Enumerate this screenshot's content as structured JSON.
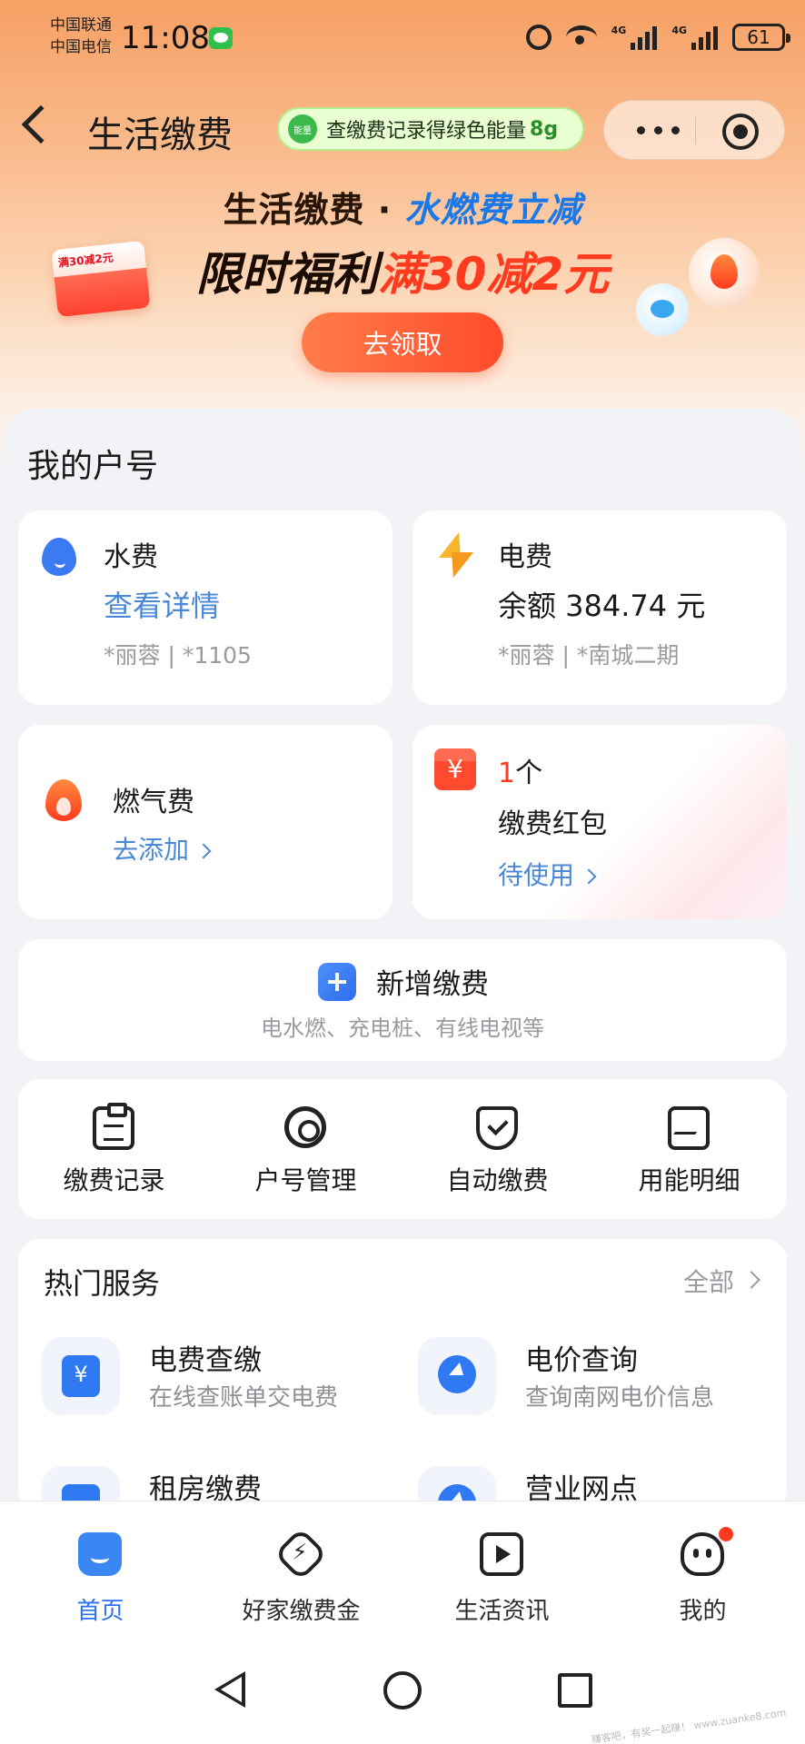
{
  "status_bar": {
    "carrier_1": "中国联通",
    "carrier_2": "中国电信",
    "time": "11:08",
    "net_1": "4G",
    "net_2": "4G",
    "battery": "61"
  },
  "header": {
    "title": "生活缴费",
    "energy_pill_badge": "能量",
    "energy_pill_text": "查缴费记录得绿色能量",
    "energy_pill_amount": "8g"
  },
  "banner": {
    "line1_prefix": "生活缴费 · ",
    "line1_highlight": "水燃费立减",
    "line2_prefix": "限时福利",
    "line2_highlight": "满30减2元",
    "redpack_label": "满30减2元",
    "button": "去领取"
  },
  "accounts": {
    "title": "我的户号",
    "water": {
      "name": "水费",
      "link": "查看详情",
      "meta": "*丽蓉 | *1105"
    },
    "electric": {
      "name": "电费",
      "balance": "余额 384.74 元",
      "meta": "*丽蓉 | *南城二期"
    },
    "gas": {
      "name": "燃气费",
      "link": "去添加"
    },
    "redpack": {
      "count_num": "1",
      "count_unit": "个",
      "name": "缴费红包",
      "link": "待使用"
    }
  },
  "add_payment": {
    "title": "新增缴费",
    "subtitle": "电水燃、充电桩、有线电视等"
  },
  "tools": [
    {
      "label": "缴费记录",
      "icon": "clipboard-icon"
    },
    {
      "label": "户号管理",
      "icon": "gear-icon"
    },
    {
      "label": "自动缴费",
      "icon": "shield-check-icon"
    },
    {
      "label": "用能明细",
      "icon": "chart-doc-icon"
    }
  ],
  "hot_services": {
    "title": "热门服务",
    "all": "全部",
    "items": [
      {
        "name": "电费查缴",
        "desc": "在线查账单交电费"
      },
      {
        "name": "电价查询",
        "desc": "查询南网电价信息"
      },
      {
        "name": "租房缴费",
        "desc": ""
      },
      {
        "name": "营业网点",
        "desc": ""
      }
    ]
  },
  "tabbar": {
    "items": [
      {
        "label": "首页",
        "active": true
      },
      {
        "label": "好家缴费金",
        "active": false
      },
      {
        "label": "生活资讯",
        "active": false
      },
      {
        "label": "我的",
        "active": false
      }
    ]
  },
  "watermark": "赚客吧，有奖一起赚！ www.zuanke8.com",
  "colors": {
    "accent": "#2e6ef0",
    "promo_red": "#ff3b1f",
    "link_blue": "#4a88d6"
  }
}
